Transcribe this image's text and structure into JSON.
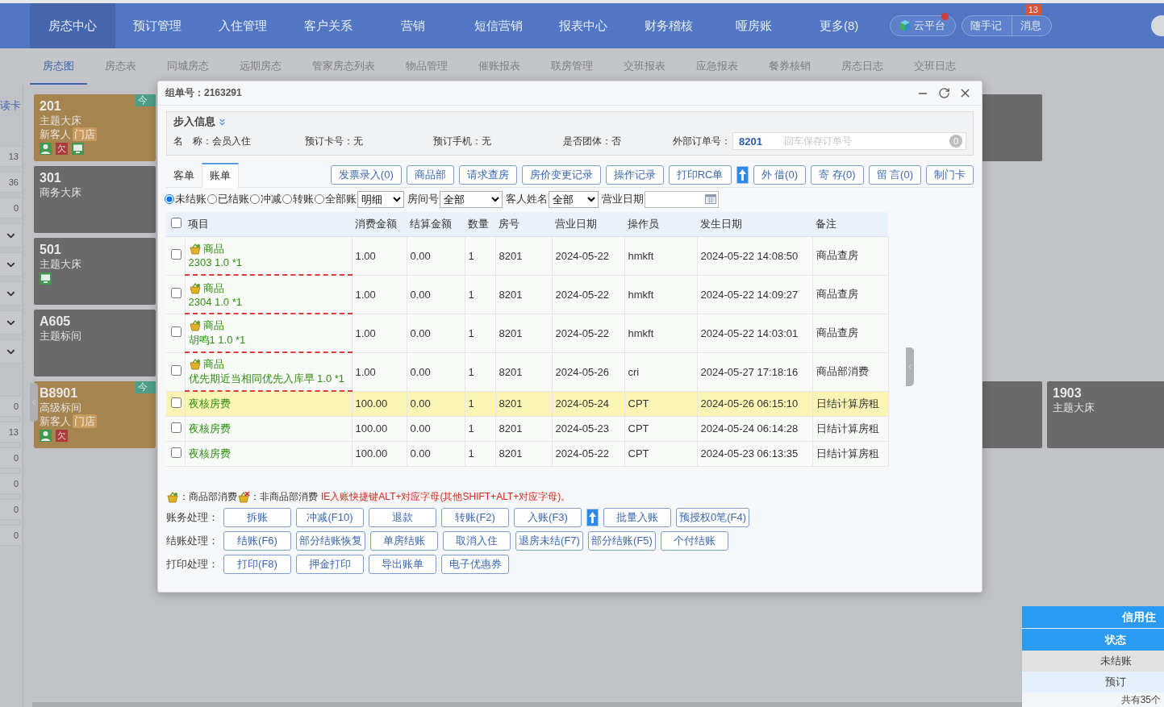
{
  "nav": {
    "items": [
      {
        "label": "房态中心",
        "selected": true
      },
      {
        "label": "预订管理",
        "selected": false
      },
      {
        "label": "入住管理",
        "selected": false
      },
      {
        "label": "客户关系",
        "selected": false
      },
      {
        "label": "营销",
        "selected": false
      },
      {
        "label": "短信营销",
        "selected": false
      },
      {
        "label": "报表中心",
        "selected": false
      },
      {
        "label": "财务稽核",
        "selected": false
      },
      {
        "label": "哑房账",
        "selected": false
      },
      {
        "label": "更多(8)",
        "selected": false
      }
    ],
    "cloud": {
      "label": "云平台",
      "notify": true
    },
    "notes": "随手记",
    "messages": {
      "label": "消息",
      "badge": "13"
    }
  },
  "subnav": [
    {
      "label": "房态图",
      "selected": true
    },
    {
      "label": "房态表",
      "selected": false
    },
    {
      "label": "同城房态",
      "selected": false
    },
    {
      "label": "远期房态",
      "selected": false
    },
    {
      "label": "管家房态列表",
      "selected": false
    },
    {
      "label": "物品管理",
      "selected": false
    },
    {
      "label": "催账报表",
      "selected": false
    },
    {
      "label": "联房管理",
      "selected": false
    },
    {
      "label": "交班报表",
      "selected": false
    },
    {
      "label": "应急报表",
      "selected": false
    },
    {
      "label": "餐券核销",
      "selected": false
    },
    {
      "label": "房态日志",
      "selected": false
    },
    {
      "label": "交班日志",
      "selected": false
    }
  ],
  "sidebar": {
    "read_card": "读卡",
    "upper": [
      {
        "kind": "count",
        "value": "13"
      },
      {
        "kind": "count",
        "value": "36"
      },
      {
        "kind": "count",
        "value": "0"
      },
      {
        "kind": "toggle",
        "expanded": false
      },
      {
        "kind": "toggle",
        "expanded": false
      },
      {
        "kind": "toggle",
        "expanded": false
      },
      {
        "kind": "toggle",
        "expanded": false
      },
      {
        "kind": "toggle",
        "expanded": false
      }
    ],
    "lower": [
      {
        "kind": "count",
        "value": "0"
      },
      {
        "kind": "count",
        "value": "13"
      },
      {
        "kind": "count",
        "value": "0"
      },
      {
        "kind": "count",
        "value": "0"
      },
      {
        "kind": "count",
        "value": "0"
      },
      {
        "kind": "count",
        "value": "0"
      }
    ]
  },
  "rooms": [
    {
      "number": "201",
      "type": "主题大床",
      "occupied": true,
      "guest": "新客人",
      "tag": "门店",
      "badge": "今",
      "guest_icon": true,
      "arrears": "欠",
      "device_icon": true
    },
    {
      "number": "301",
      "type": "商务大床",
      "occupied": false
    },
    {
      "number": "501",
      "type": "主题大床",
      "occupied": false,
      "device_icon": true
    },
    {
      "number": "A605",
      "type": "主题标间",
      "occupied": false
    },
    {
      "number": "B8901",
      "type": "高级标间",
      "occupied": true,
      "guest": "新客人",
      "tag": "门店",
      "badge": "今",
      "guest_icon": true,
      "arrears": "欠"
    }
  ],
  "far_rooms": [
    {
      "number": "1903",
      "type": "主题大床",
      "occupied": false
    }
  ],
  "credit_panel": {
    "title": "信用住",
    "header": "状态",
    "rows": [
      "未结账",
      "预订"
    ],
    "footer": "共有35个"
  },
  "dialog": {
    "title": "组单号：2163291",
    "info": {
      "legend": "步入信息",
      "expanded": true,
      "fields": [
        {
          "label": "名　称：",
          "value": "会员入住"
        },
        {
          "label": "预订卡号：",
          "value": "无"
        },
        {
          "label": "预订手机：",
          "value": "无"
        },
        {
          "label": "是否团体：",
          "value": "否"
        }
      ],
      "external_order": {
        "label": "外部订单号：",
        "value": "8201",
        "placeholder": "回车保存订单号",
        "count": "0"
      }
    },
    "tabs": [
      {
        "label": "客单",
        "selected": false
      },
      {
        "label": "账单",
        "selected": true
      }
    ],
    "toolbar": [
      {
        "kind": "button",
        "label": "发票录入(0)"
      },
      {
        "kind": "button",
        "label": "商品部"
      },
      {
        "kind": "button",
        "label": "请求查房"
      },
      {
        "kind": "button",
        "label": "房价变更记录"
      },
      {
        "kind": "button",
        "label": "操作记录"
      },
      {
        "kind": "button",
        "label": "打印RC单"
      },
      {
        "kind": "arrow"
      },
      {
        "kind": "button",
        "label": "外 借(0)"
      },
      {
        "kind": "button",
        "label": "寄 存(0)"
      },
      {
        "kind": "button",
        "label": "留 言(0)"
      },
      {
        "kind": "button",
        "label": "制门卡"
      }
    ],
    "filters": {
      "status": [
        {
          "label": "未结账",
          "selected": true
        },
        {
          "label": "已结账",
          "selected": false
        },
        {
          "label": "冲减",
          "selected": false
        },
        {
          "label": "转账",
          "selected": false
        },
        {
          "label": "全部账",
          "selected": false
        }
      ],
      "detail": "明细",
      "room_label": "房间号",
      "room": "全部",
      "guest_label": "客人姓名",
      "guest": "全部",
      "date_label": "营业日期"
    },
    "table": {
      "all_checked": false,
      "columns": [
        "项目",
        "消费金额",
        "结算金额",
        "数量",
        "房号",
        "营业日期",
        "操作员",
        "发生日期",
        "备注"
      ],
      "rows": [
        {
          "kind": "goods",
          "selected": false,
          "checked": false,
          "item": "商品",
          "detail": "2303 1.0 *1",
          "amount": "1.00",
          "settled": "0.00",
          "qty": "1",
          "room": "8201",
          "biz_date": "2024-05-22",
          "operator": "hmkft",
          "time": "2024-05-22 14:08:50",
          "note": "商品查房"
        },
        {
          "kind": "goods",
          "selected": false,
          "checked": false,
          "item": "商品",
          "detail": "2304 1.0 *1",
          "amount": "1.00",
          "settled": "0.00",
          "qty": "1",
          "room": "8201",
          "biz_date": "2024-05-22",
          "operator": "hmkft",
          "time": "2024-05-22 14:09:27",
          "note": "商品查房"
        },
        {
          "kind": "goods",
          "selected": false,
          "checked": false,
          "item": "商品",
          "detail": "胡鸣1 1.0 *1",
          "amount": "1.00",
          "settled": "0.00",
          "qty": "1",
          "room": "8201",
          "biz_date": "2024-05-22",
          "operator": "hmkft",
          "time": "2024-05-22 14:03:01",
          "note": "商品查房"
        },
        {
          "kind": "goods",
          "selected": false,
          "checked": false,
          "item": "商品",
          "detail": "优先期近当相同优先入库早 1.0 *1",
          "amount": "1.00",
          "settled": "0.00",
          "qty": "1",
          "room": "8201",
          "biz_date": "2024-05-26",
          "operator": "cri",
          "time": "2024-05-27 17:18:16",
          "note": "商品部消费"
        },
        {
          "kind": "room",
          "selected": true,
          "checked": false,
          "item": "夜核房费",
          "amount": "100.00",
          "settled": "0.00",
          "qty": "1",
          "room": "8201",
          "biz_date": "2024-05-24",
          "operator": "CPT",
          "time": "2024-05-26 06:15:10",
          "note": "日结计算房租"
        },
        {
          "kind": "room",
          "selected": false,
          "checked": false,
          "item": "夜核房费",
          "amount": "100.00",
          "settled": "0.00",
          "qty": "1",
          "room": "8201",
          "biz_date": "2024-05-23",
          "operator": "CPT",
          "time": "2024-05-24 06:14:28",
          "note": "日结计算房租"
        },
        {
          "kind": "room",
          "selected": false,
          "checked": false,
          "item": "夜核房费",
          "amount": "100.00",
          "settled": "0.00",
          "qty": "1",
          "room": "8201",
          "biz_date": "2024-05-22",
          "operator": "CPT",
          "time": "2024-05-23 06:13:35",
          "note": "日结计算房租"
        }
      ]
    },
    "legend": {
      "goods": "：商品部消费",
      "other": "：非商品部消费",
      "hint": "IE入账快捷键ALT+对应字母(其他SHIFT+ALT+对应字母)。"
    },
    "actions": [
      {
        "label": "账务处理：",
        "buttons": [
          {
            "kind": "button",
            "label": "拆账"
          },
          {
            "kind": "button",
            "label": "冲减(F10)"
          },
          {
            "kind": "button",
            "label": "退款"
          },
          {
            "kind": "button",
            "label": "转账(F2)"
          },
          {
            "kind": "button",
            "label": "入账(F3)"
          },
          {
            "kind": "arrow"
          },
          {
            "kind": "button",
            "label": "批量入账"
          },
          {
            "kind": "button",
            "label": "预授权0笔(F4)"
          }
        ]
      },
      {
        "label": "结账处理：",
        "buttons": [
          {
            "kind": "button",
            "label": "结账(F6)"
          },
          {
            "kind": "button",
            "label": "部分结账恢复"
          },
          {
            "kind": "button",
            "label": "单房结账"
          },
          {
            "kind": "button",
            "label": "取消入住"
          },
          {
            "kind": "button",
            "label": "退房未结(F7)"
          },
          {
            "kind": "button",
            "label": "部分结账(F5)"
          },
          {
            "kind": "button",
            "label": "个付结账"
          }
        ]
      },
      {
        "label": "打印处理：",
        "buttons": [
          {
            "kind": "button",
            "label": "打印(F8)"
          },
          {
            "kind": "button",
            "label": "押金打印"
          },
          {
            "kind": "button",
            "label": "导出账单"
          },
          {
            "kind": "button",
            "label": "电子优惠券"
          }
        ]
      }
    ]
  }
}
